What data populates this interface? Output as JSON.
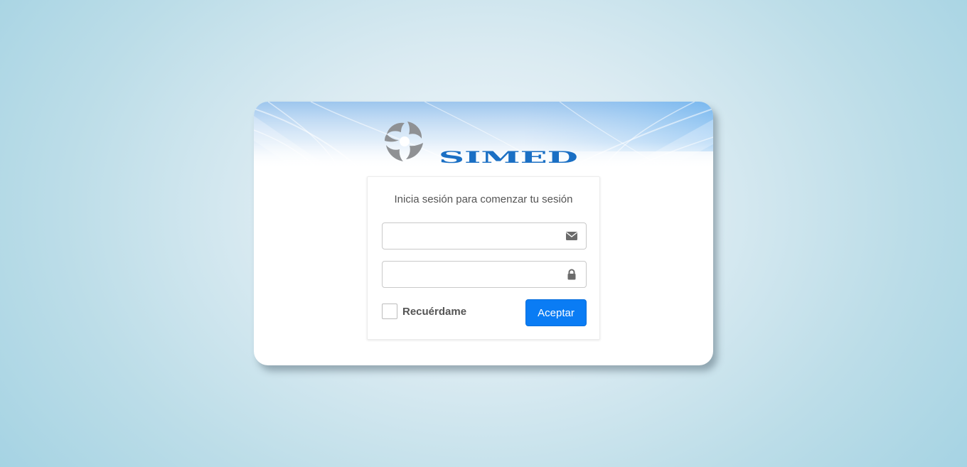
{
  "brand": {
    "name": "SIMED"
  },
  "login": {
    "message": "Inicia sesión para comenzar tu sesión",
    "email": {
      "value": "",
      "placeholder": "",
      "icon": "envelope-icon"
    },
    "password": {
      "value": "",
      "placeholder": "",
      "icon": "lock-icon"
    },
    "remember_label": "Recuérdame",
    "remember_checked": false,
    "submit_label": "Aceptar"
  },
  "colors": {
    "accent": "#0a7cf4",
    "brand_blue": "#1a6fc4",
    "logo_gray": "#8f9194"
  }
}
